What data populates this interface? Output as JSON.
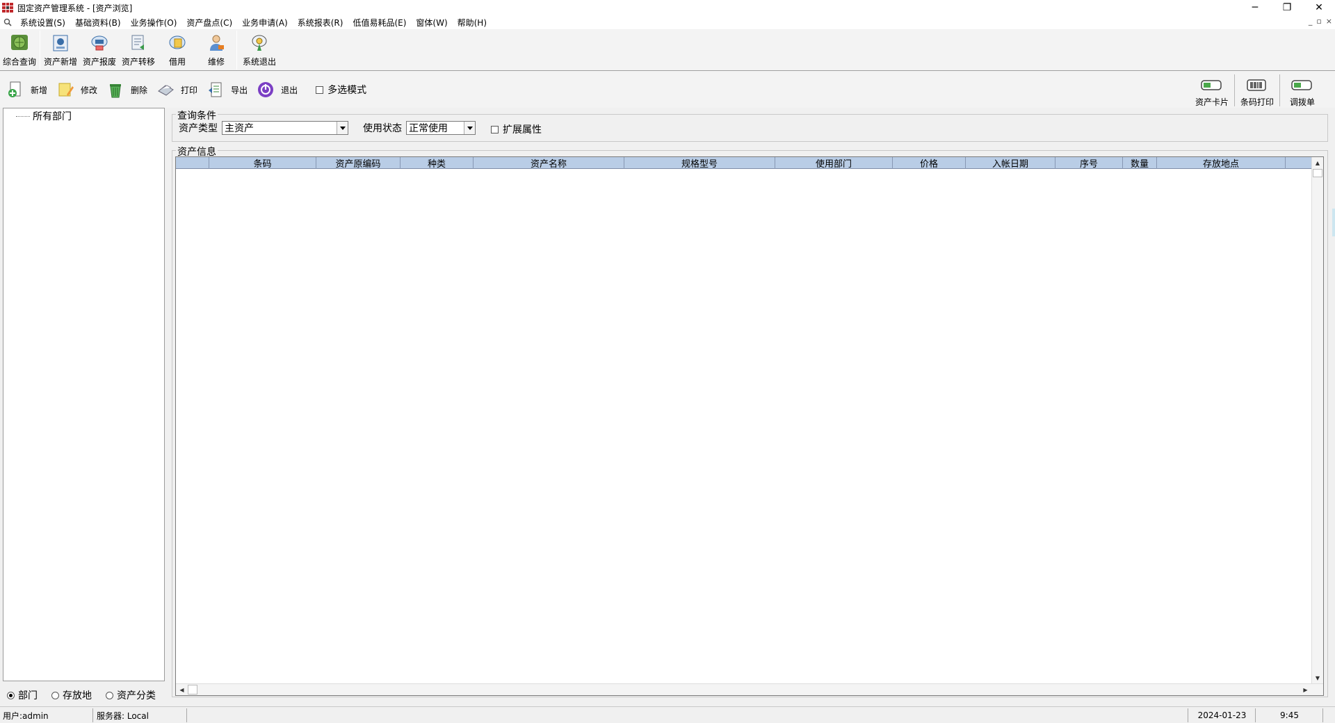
{
  "window": {
    "title": "固定资产管理系统 - [资产浏览]",
    "controls": {
      "minimize": "─",
      "restore": "❐",
      "close": "✕"
    },
    "mdi_controls": {
      "minimize": "_",
      "restore": "▫",
      "close": "×"
    }
  },
  "menu": {
    "items": [
      {
        "label": "系统设置(S)"
      },
      {
        "label": "基础资料(B)"
      },
      {
        "label": "业务操作(O)"
      },
      {
        "label": "资产盘点(C)"
      },
      {
        "label": "业务申请(A)"
      },
      {
        "label": "系统报表(R)"
      },
      {
        "label": "低值易耗品(E)"
      },
      {
        "label": "窗体(W)"
      },
      {
        "label": "帮助(H)"
      }
    ]
  },
  "main_toolbar": {
    "buttons": [
      {
        "label": "综合查询",
        "icon": "globe-search-icon"
      },
      {
        "label": "资产新增",
        "icon": "asset-add-icon"
      },
      {
        "label": "资产报废",
        "icon": "asset-scrap-icon"
      },
      {
        "label": "资产转移",
        "icon": "asset-transfer-icon"
      },
      {
        "label": "借用",
        "icon": "borrow-icon"
      },
      {
        "label": "维修",
        "icon": "repair-person-icon"
      },
      {
        "label": "系统退出",
        "icon": "exit-key-icon"
      }
    ]
  },
  "action_toolbar": {
    "buttons": [
      {
        "label": "新增",
        "icon": "add-document-icon"
      },
      {
        "label": "修改",
        "icon": "edit-note-icon"
      },
      {
        "label": "删除",
        "icon": "trash-icon"
      },
      {
        "label": "打印",
        "icon": "printer-icon"
      },
      {
        "label": "导出",
        "icon": "export-icon"
      },
      {
        "label": "退出",
        "icon": "power-icon"
      }
    ],
    "multi_select": {
      "label": "多选模式",
      "checked": false
    },
    "right_buttons": [
      {
        "label": "资产卡片",
        "icon": "asset-card-icon"
      },
      {
        "label": "条码打印",
        "icon": "barcode-print-icon"
      },
      {
        "label": "调拨单",
        "icon": "transfer-slip-icon"
      }
    ]
  },
  "tree": {
    "root": "所有部门",
    "view_modes": [
      {
        "label": "部门",
        "selected": true
      },
      {
        "label": "存放地",
        "selected": false
      },
      {
        "label": "资产分类",
        "selected": false
      }
    ]
  },
  "query": {
    "title": "查询条件",
    "asset_type": {
      "label": "资产类型",
      "value": "主资产"
    },
    "use_status": {
      "label": "使用状态",
      "value": "正常使用"
    },
    "extended_attr": {
      "label": "扩展属性",
      "checked": false
    }
  },
  "asset_grid": {
    "title": "资产信息",
    "columns": [
      "",
      "条码",
      "资产原编码",
      "种类",
      "资产名称",
      "规格型号",
      "使用部门",
      "价格",
      "入帐日期",
      "序号",
      "数量",
      "存放地点",
      ""
    ],
    "rows": []
  },
  "status_bar": {
    "user": "用户:admin",
    "server": "服务器: Local",
    "date": "2024-01-23",
    "time": "9:45"
  }
}
